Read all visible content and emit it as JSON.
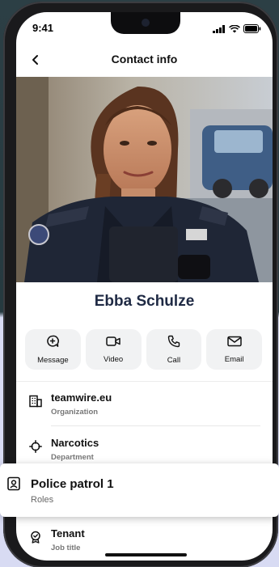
{
  "status_bar": {
    "time": "9:41"
  },
  "nav": {
    "title": "Contact info"
  },
  "contact": {
    "name": "Ebba Schulze"
  },
  "actions": [
    {
      "label": "Message",
      "icon": "message-plus-icon"
    },
    {
      "label": "Video",
      "icon": "video-camera-icon"
    },
    {
      "label": "Call",
      "icon": "phone-icon"
    },
    {
      "label": "Email",
      "icon": "envelope-icon"
    }
  ],
  "details": [
    {
      "value": "teamwire.eu",
      "label": "Organization",
      "icon": "building-icon"
    },
    {
      "value": "Narcotics",
      "label": "Department",
      "icon": "target-icon"
    },
    {
      "value": "Police patrol 1",
      "label": "Roles",
      "icon": "id-badge-icon"
    },
    {
      "value": "Tenant",
      "label": "Job title",
      "icon": "badge-icon"
    }
  ],
  "colors": {
    "accent": "#1f2a44",
    "button_bg": "#f1f2f3",
    "page_bg": "#d8dbf3"
  }
}
